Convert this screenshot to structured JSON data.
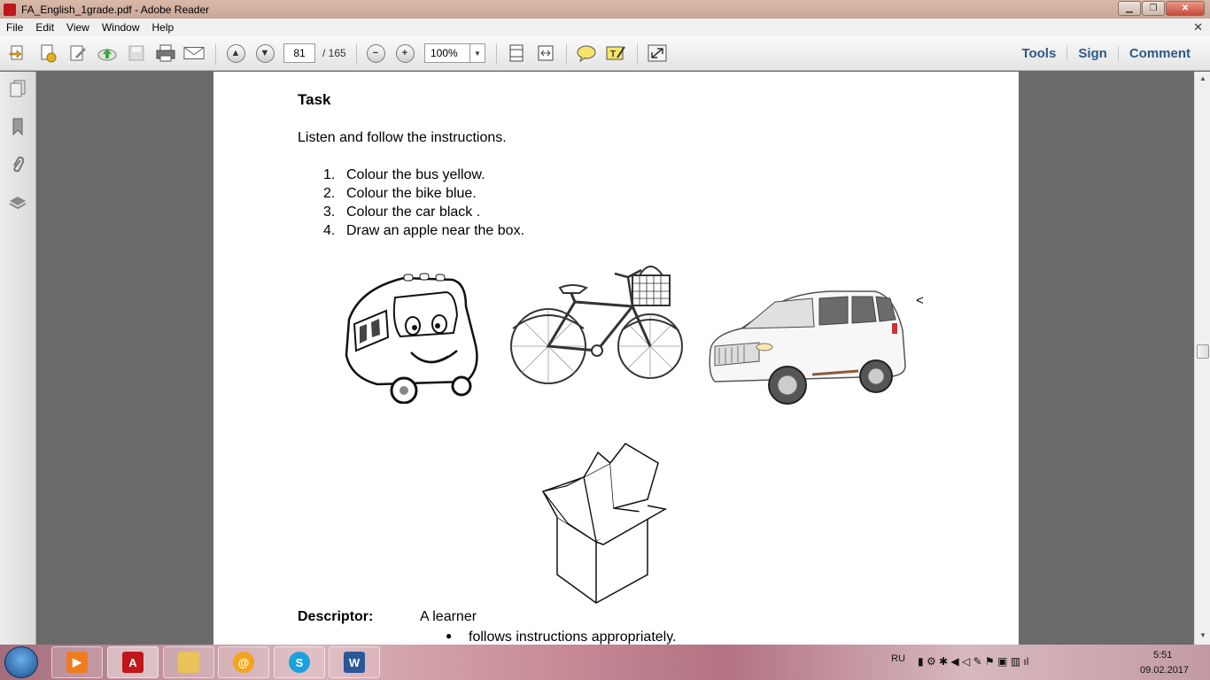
{
  "window": {
    "title": "FA_English_1grade.pdf - Adobe Reader"
  },
  "menu": [
    "File",
    "Edit",
    "View",
    "Window",
    "Help"
  ],
  "toolbar": {
    "page_current": "81",
    "page_total": "/ 165",
    "zoom": "100%",
    "links": [
      "Tools",
      "Sign",
      "Comment"
    ]
  },
  "document": {
    "task_heading": "Task",
    "intro": "Listen and follow the instructions.",
    "instructions": [
      {
        "num": "1.",
        "text": "Colour the bus yellow."
      },
      {
        "num": "2.",
        "text": "Colour the bike blue."
      },
      {
        "num": "3.",
        "text": "Colour the car black ."
      },
      {
        "num": "4.",
        "text": "Draw an apple near the box."
      }
    ],
    "stray_mark": "<",
    "descriptor_label": "Descriptor:",
    "descriptor_text": "A learner",
    "descriptor_bullet": "follows instructions appropriately."
  },
  "tray": {
    "language": "RU",
    "time": "5:51",
    "date": "09.02.2017"
  },
  "colors": {
    "link": "#2e5a86",
    "acrobat_red": "#c0161c",
    "doc_bg": "#6a6a6a"
  }
}
